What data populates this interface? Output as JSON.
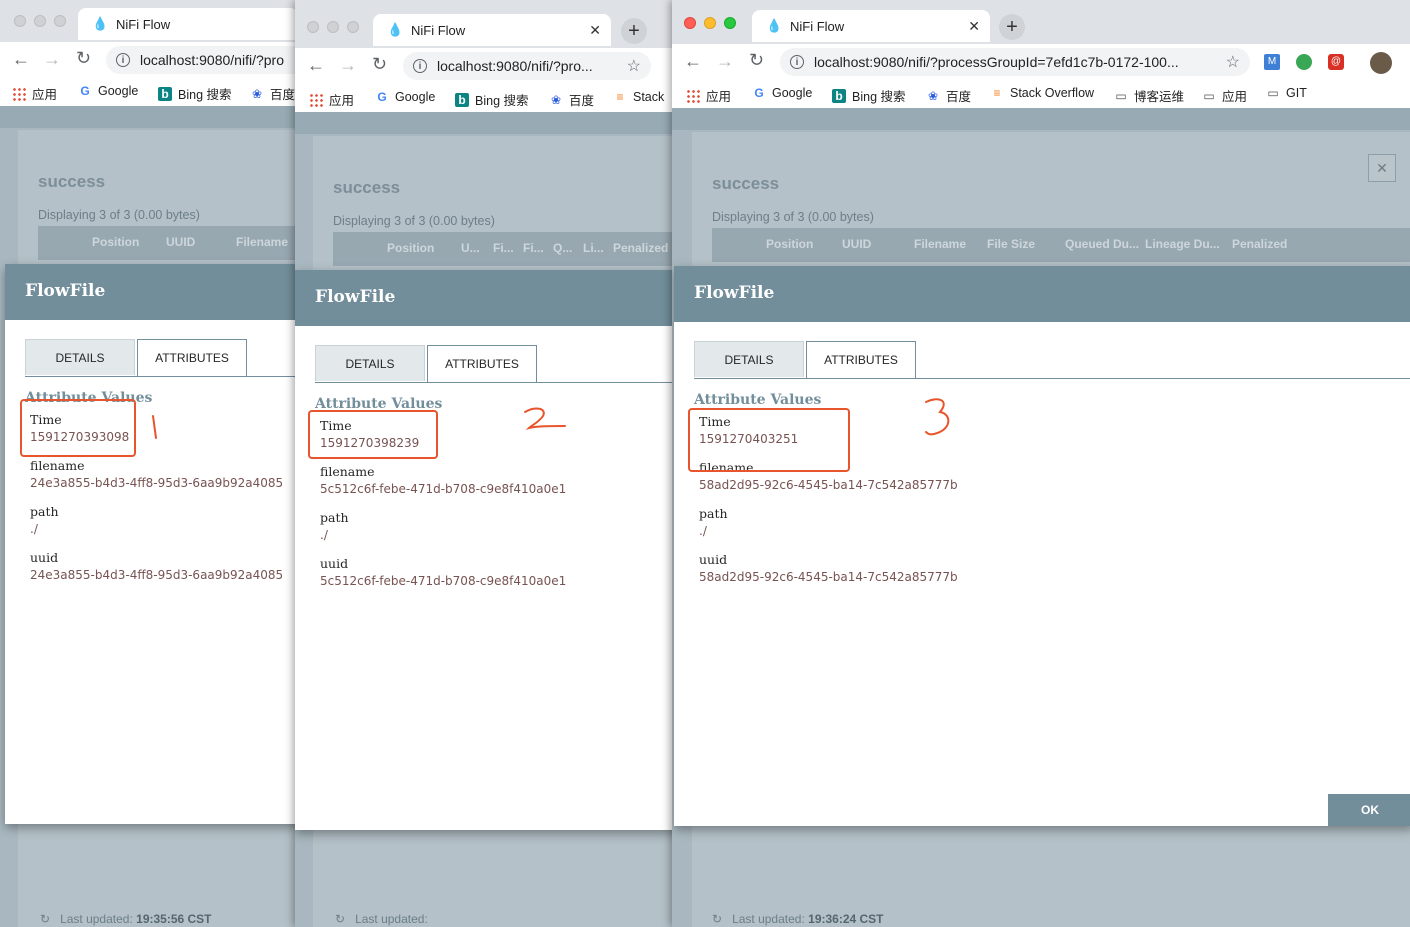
{
  "windows": [
    {
      "tab_title": "NiFi Flow",
      "url": "localhost:9080/nifi/?pro",
      "bookmarks": [
        "应用",
        "Google",
        "Bing 搜索",
        "百度"
      ],
      "bg_dialog": {
        "title": "success",
        "displaying": "Displaying 3 of 3 (0.00 bytes)",
        "columns": [
          "Position",
          "UUID",
          "Filename"
        ]
      },
      "modal": {
        "title": "FlowFile",
        "tabs": [
          "DETAILS",
          "ATTRIBUTES"
        ],
        "active_tab": "ATTRIBUTES",
        "attr_title": "Attribute Values",
        "attributes": [
          {
            "name": "Time",
            "value": "1591270393098"
          },
          {
            "name": "filename",
            "value": "24e3a855-b4d3-4ff8-95d3-6aa9b92a4085"
          },
          {
            "name": "path",
            "value": "./"
          },
          {
            "name": "uuid",
            "value": "24e3a855-b4d3-4ff8-95d3-6aa9b92a4085"
          }
        ]
      },
      "annotation": "1",
      "footer": {
        "label": "Last updated:",
        "time": "19:35:56 CST"
      }
    },
    {
      "tab_title": "NiFi Flow",
      "url": "localhost:9080/nifi/?pro...",
      "bookmarks": [
        "应用",
        "Google",
        "Bing 搜索",
        "百度",
        "Stack"
      ],
      "bg_dialog": {
        "title": "success",
        "displaying": "Displaying 3 of 3 (0.00 bytes)",
        "columns": [
          "Position",
          "U...",
          "Fi...",
          "Fi...",
          "Q...",
          "Li...",
          "Penalized"
        ]
      },
      "modal": {
        "title": "FlowFile",
        "tabs": [
          "DETAILS",
          "ATTRIBUTES"
        ],
        "active_tab": "ATTRIBUTES",
        "attr_title": "Attribute Values",
        "attributes": [
          {
            "name": "Time",
            "value": "1591270398239"
          },
          {
            "name": "filename",
            "value": "5c512c6f-febe-471d-b708-c9e8f410a0e1"
          },
          {
            "name": "path",
            "value": "./"
          },
          {
            "name": "uuid",
            "value": "5c512c6f-febe-471d-b708-c9e8f410a0e1"
          }
        ]
      },
      "annotation": "2",
      "footer": {
        "label": "Last updated:",
        "time": ""
      }
    },
    {
      "tab_title": "NiFi Flow",
      "url": "localhost:9080/nifi/?processGroupId=7efd1c7b-0172-100...",
      "bookmarks": [
        "应用",
        "Google",
        "Bing 搜索",
        "百度",
        "Stack Overflow",
        "博客运维",
        "应用",
        "GIT"
      ],
      "bg_dialog": {
        "title": "success",
        "displaying": "Displaying 3 of 3 (0.00 bytes)",
        "columns": [
          "Position",
          "UUID",
          "Filename",
          "File Size",
          "Queued Du...",
          "Lineage Du...",
          "Penalized"
        ]
      },
      "modal": {
        "title": "FlowFile",
        "tabs": [
          "DETAILS",
          "ATTRIBUTES"
        ],
        "active_tab": "ATTRIBUTES",
        "attr_title": "Attribute Values",
        "attributes": [
          {
            "name": "Time",
            "value": "1591270403251"
          },
          {
            "name": "filename",
            "value": "58ad2d95-92c6-4545-ba14-7c542a85777b"
          },
          {
            "name": "path",
            "value": "./"
          },
          {
            "name": "uuid",
            "value": "58ad2d95-92c6-4545-ba14-7c542a85777b"
          }
        ],
        "ok_label": "OK"
      },
      "annotation": "3",
      "footer": {
        "label": "Last updated:",
        "time": "19:36:24 CST"
      }
    }
  ],
  "colors": {
    "nifi_header": "#728e9b",
    "attr_value": "#775351",
    "highlight": "#e8542c"
  }
}
